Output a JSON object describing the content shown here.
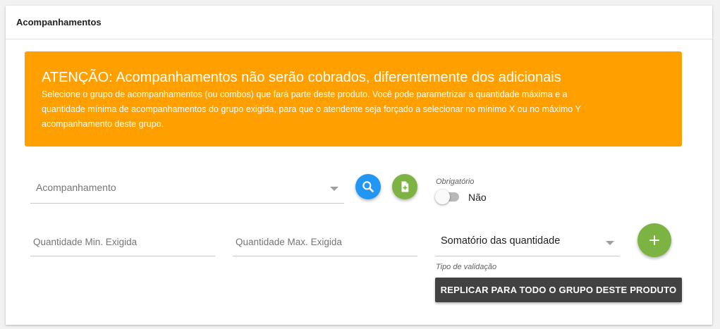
{
  "card": {
    "title": "Acompanhamentos"
  },
  "alert": {
    "title": "ATENÇÃO: Acompanhamentos não serão cobrados, diferentemente dos adicionais",
    "text_line1": "Selecione o grupo de acompanhamentos (ou combos) que fará parte deste produto. Você pode parametrizar a quantidade máxima e a",
    "text_line2": "quantidade mínima de acompanhamentos do grupo exigida, para que o atendente seja forçado a selecionar no mínimo X ou no máximo Y",
    "text_line3": "acompanhamento deste grupo.",
    "color": "#ffa000"
  },
  "acompanhamento_select": {
    "placeholder": "Acompanhamento"
  },
  "buttons": {
    "search_icon": "search-icon",
    "search_color": "#2196f3",
    "add_icon": "add-document-icon",
    "add_color": "#7cb342",
    "add_group_icon": "plus-icon",
    "replicate_label": "REPLICAR PARA TODO O GRUPO DESTE PRODUTO"
  },
  "obrigatorio": {
    "label": "Obrigatório",
    "state": "Não"
  },
  "quantidade_min": {
    "placeholder": "Quantidade Min. Exigida"
  },
  "quantidade_max": {
    "placeholder": "Quantidade Max. Exigida"
  },
  "tipo_validacao": {
    "value": "Somatório das quantidade",
    "helper": "Tipo de validação"
  }
}
